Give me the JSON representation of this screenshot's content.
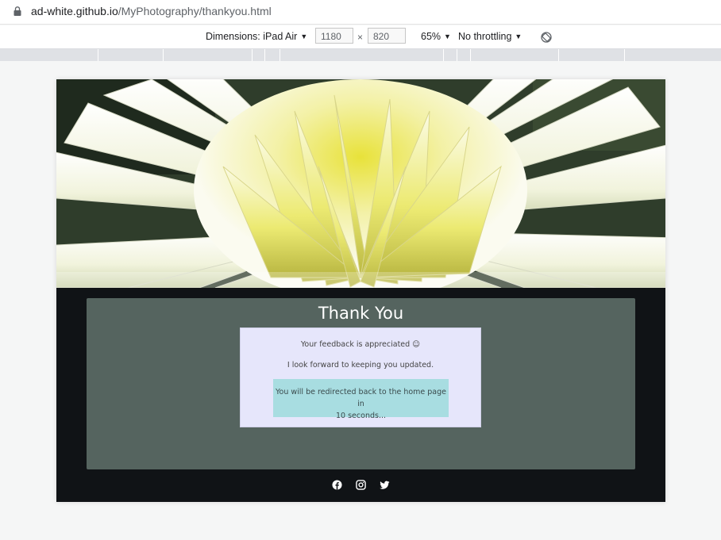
{
  "browser": {
    "url_domain": "ad-white.github.io",
    "url_path": "/MyPhotography/thankyou.html"
  },
  "devtools": {
    "dimensions_label": "Dimensions: iPad Air",
    "width_value": "1180",
    "times": "×",
    "height_value": "820",
    "zoom_label": "65%",
    "throttling_label": "No throttling"
  },
  "hero": {
    "subject": "white and yellow dahlia flower close-up"
  },
  "content": {
    "title": "Thank You",
    "message_line1": "Your feedback is appreciated ☺",
    "message_line2": "I look forward to keeping you updated.",
    "redirect_line1": "You will be redirected back to the home page in",
    "redirect_line2": "10 seconds..."
  },
  "footer": {
    "icons": [
      "facebook-icon",
      "instagram-icon",
      "twitter-icon"
    ]
  },
  "colors": {
    "page_bg": "#101316",
    "card_bg": "#55645f",
    "message_bg": "#e6e6fb",
    "redirect_bg": "#a8dde1"
  }
}
